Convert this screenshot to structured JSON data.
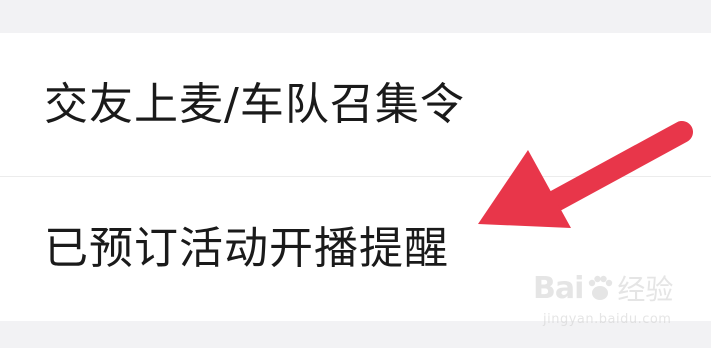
{
  "menu": {
    "items": [
      {
        "label": "交友上麦/车队召集令"
      },
      {
        "label": "已预订活动开播提醒"
      }
    ]
  },
  "annotation": {
    "arrow_color": "#e8364a",
    "arrow_icon": "arrow-pointing-down-left"
  },
  "watermark": {
    "logo_left": "Bai",
    "logo_right": "经验",
    "url": "jingyan.baidu.com"
  }
}
